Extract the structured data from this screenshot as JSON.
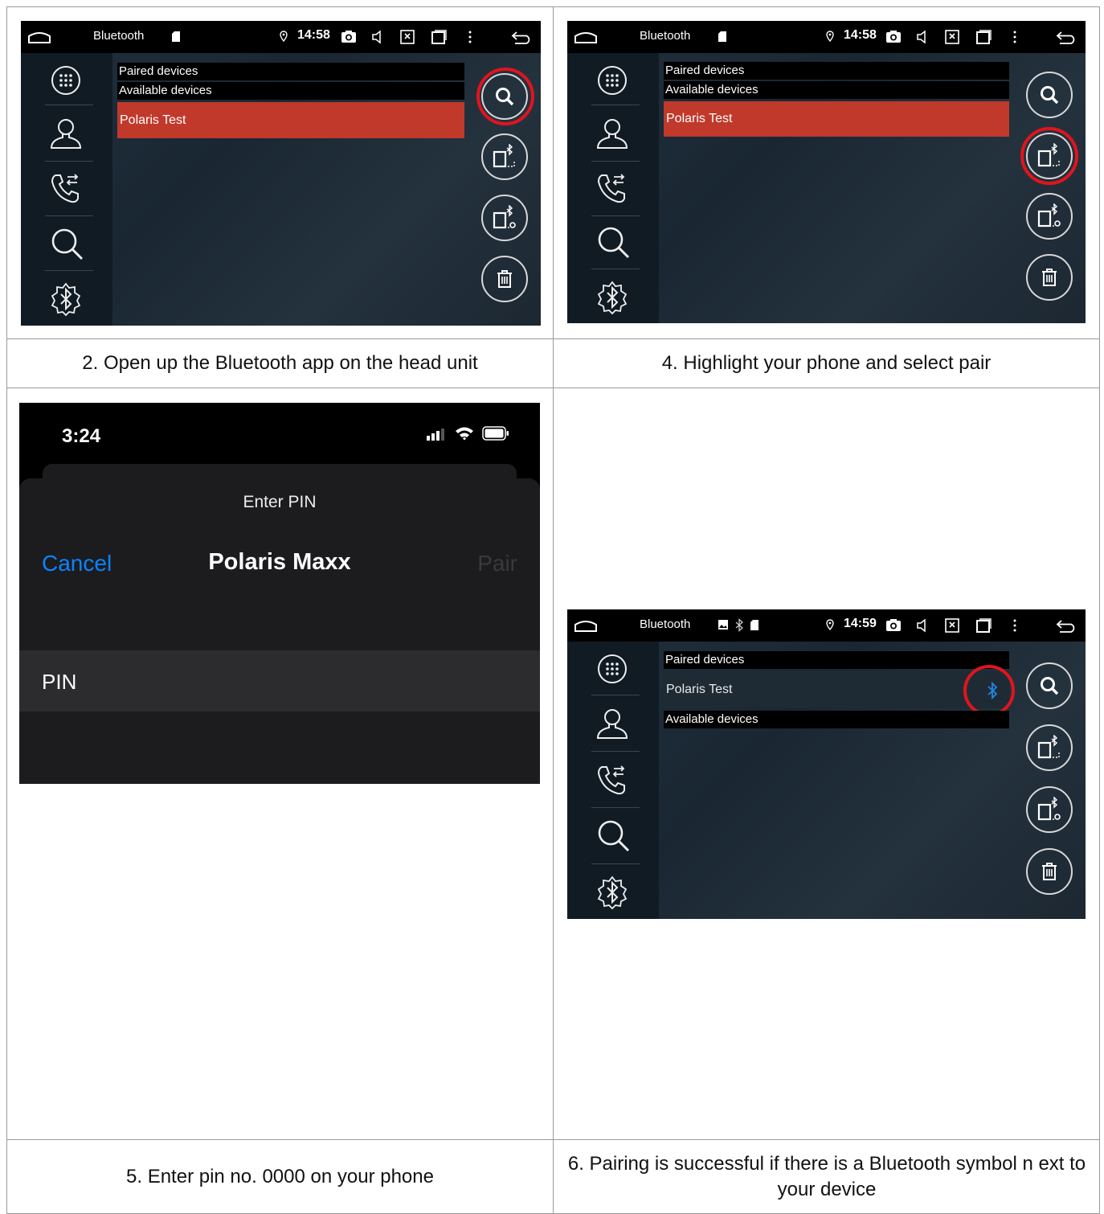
{
  "cells": {
    "top_left": {
      "caption": "2. Open up the Bluetooth app on the head unit",
      "screen": {
        "app_title": "Bluetooth",
        "clock": "14:58",
        "paired_header": "Paired devices",
        "available_header": "Available devices",
        "device_name": "Polaris Test",
        "highlight_target": "search-button"
      }
    },
    "top_right": {
      "caption": "4. Highlight your phone and select pair",
      "screen": {
        "app_title": "Bluetooth",
        "clock": "14:58",
        "paired_header": "Paired devices",
        "available_header": "Available devices",
        "device_name": "Polaris Test",
        "highlight_target": "pair-button"
      }
    },
    "bottom_left": {
      "caption": "5. Enter pin no. 0000 on your phone",
      "phone": {
        "time": "3:24",
        "sheet_title": "Enter PIN",
        "cancel_label": "Cancel",
        "device_name": "Polaris Maxx",
        "pair_label": "Pair",
        "pin_label": "PIN"
      }
    },
    "bottom_right": {
      "caption": "6. Pairing is successful if there is a Bluetooth symbol n ext to your device",
      "screen": {
        "app_title": "Bluetooth",
        "clock": "14:59",
        "paired_header": "Paired devices",
        "paired_device_name": "Polaris Test",
        "available_header": "Available devices",
        "highlight_target": "bluetooth-connected-icon"
      }
    }
  },
  "colors": {
    "highlight_red": "#c0392b",
    "ring_red": "#e0141e",
    "ios_blue": "#0a84ff",
    "bluetooth_blue": "#1e88e5"
  }
}
